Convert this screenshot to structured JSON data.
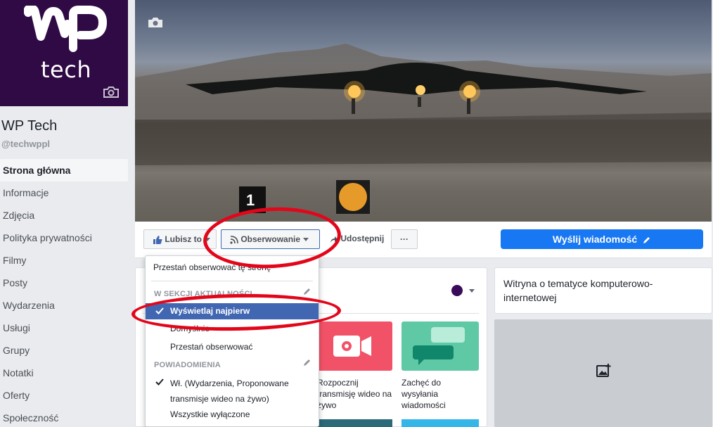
{
  "page": {
    "name": "WP Tech",
    "handle": "@techwppl",
    "logo_text": "tech"
  },
  "sidebar": {
    "items": [
      {
        "label": "Strona główna",
        "active": true
      },
      {
        "label": "Informacje"
      },
      {
        "label": "Zdjęcia"
      },
      {
        "label": "Polityka prywatności"
      },
      {
        "label": "Filmy"
      },
      {
        "label": "Posty"
      },
      {
        "label": "Wydarzenia"
      },
      {
        "label": "Usługi"
      },
      {
        "label": "Grupy"
      },
      {
        "label": "Notatki"
      },
      {
        "label": "Oferty"
      },
      {
        "label": "Społeczność"
      }
    ]
  },
  "actions": {
    "like_label": "Lubisz to",
    "follow_label": "Obserwowanie",
    "share_label": "Udostępnij",
    "more_label": "···",
    "message_label": "Wyślij wiadomość"
  },
  "dropdown": {
    "unfollow_page": "Przestań obserwować tę stronę",
    "news_header": "W SEKCJI AKTUALNOŚCI",
    "show_first": "Wyświetlaj najpierw",
    "default": "Domyślnie",
    "unfollow": "Przestań obserwować",
    "notifications_header": "POWIADOMIENIA",
    "notifications_on": "Wł. (Wydarzenia, Proponowane transmisje wideo na żywo)",
    "all_off": "Wszystkie wyłączone"
  },
  "content": {
    "video_tile_label": "Rozpocznij transmisję wideo na żywo",
    "chat_tile_label": "Zachęć do wysyłania wiadomości",
    "about_text": "Witryna o tematyce komputerowo-internetowej"
  },
  "colors": {
    "brand_purple": "#2f0a45",
    "primary_blue": "#1877f2",
    "selection_blue": "#4267b2",
    "annotation_red": "#e3061a"
  }
}
